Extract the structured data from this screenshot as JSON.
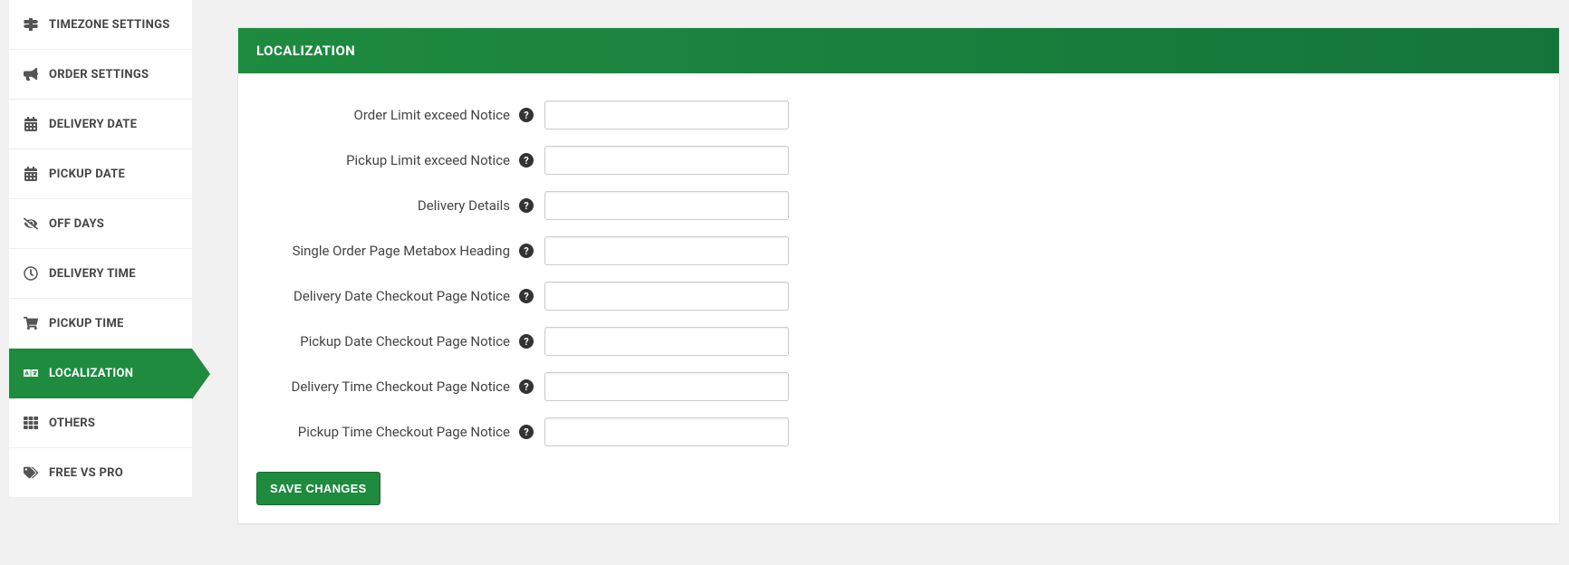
{
  "sidebar": {
    "items": [
      {
        "label": "TIMEZONE SETTINGS",
        "icon": "map-signs-icon",
        "active": false
      },
      {
        "label": "ORDER SETTINGS",
        "icon": "bullhorn-icon",
        "active": false
      },
      {
        "label": "DELIVERY DATE",
        "icon": "calendar-icon",
        "active": false
      },
      {
        "label": "PICKUP DATE",
        "icon": "calendar-icon",
        "active": false
      },
      {
        "label": "OFF DAYS",
        "icon": "eye-slash-icon",
        "active": false
      },
      {
        "label": "DELIVERY TIME",
        "icon": "clock-icon",
        "active": false
      },
      {
        "label": "PICKUP TIME",
        "icon": "cart-icon",
        "active": false
      },
      {
        "label": "LOCALIZATION",
        "icon": "language-icon",
        "active": true
      },
      {
        "label": "OTHERS",
        "icon": "grid-icon",
        "active": false
      },
      {
        "label": "FREE VS PRO",
        "icon": "tags-icon",
        "active": false
      }
    ]
  },
  "panel": {
    "title": "LOCALIZATION",
    "fields": [
      {
        "label": "Order Limit exceed Notice",
        "value": ""
      },
      {
        "label": "Pickup Limit exceed Notice",
        "value": ""
      },
      {
        "label": "Delivery Details",
        "value": ""
      },
      {
        "label": "Single Order Page Metabox Heading",
        "value": ""
      },
      {
        "label": "Delivery Date Checkout Page Notice",
        "value": ""
      },
      {
        "label": "Pickup Date Checkout Page Notice",
        "value": ""
      },
      {
        "label": "Delivery Time Checkout Page Notice",
        "value": ""
      },
      {
        "label": "Pickup Time Checkout Page Notice",
        "value": ""
      }
    ],
    "save_label": "SAVE CHANGES"
  }
}
